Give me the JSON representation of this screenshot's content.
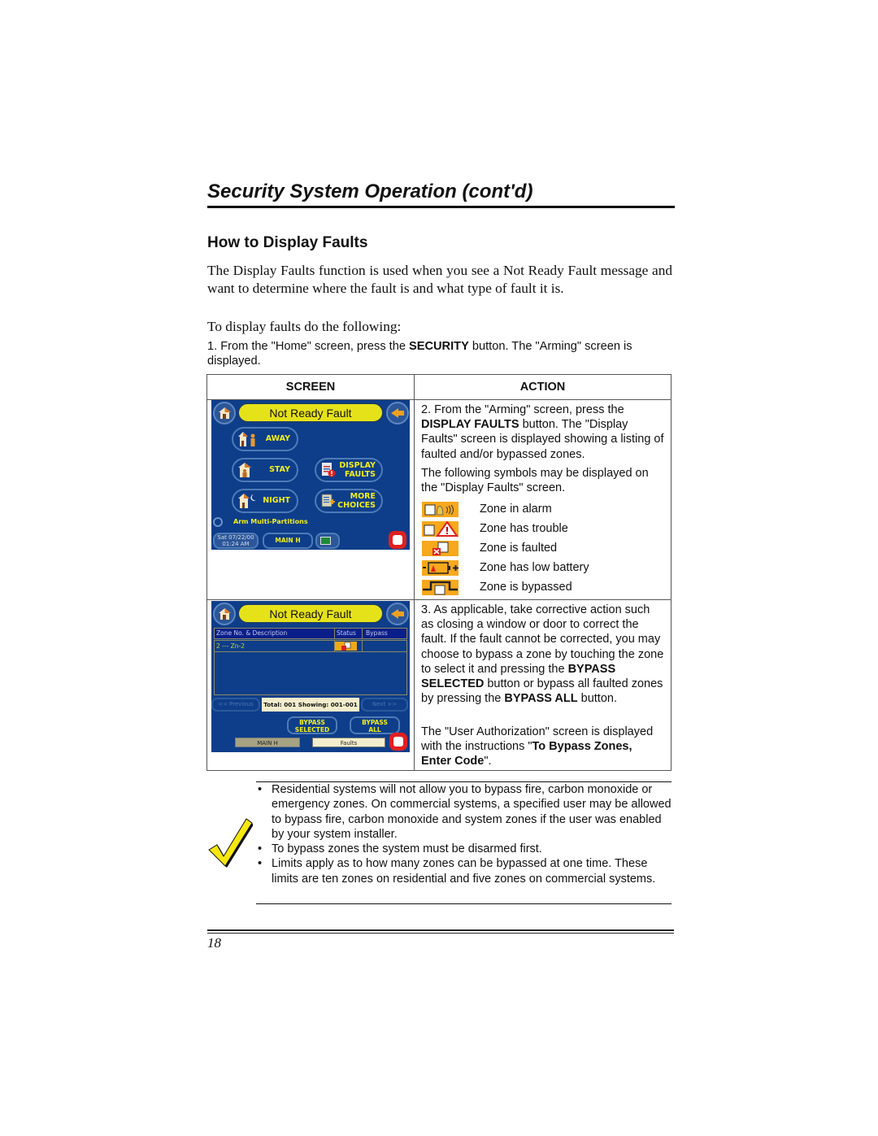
{
  "header": {
    "title": "Security System Operation (cont'd)",
    "section_heading": "How to Display Faults"
  },
  "intro": {
    "paragraph": "The Display Faults function is used when you see a Not Ready Fault message and want to determine where the fault is and what type of fault it is.",
    "lead_in": "To display faults do the following:",
    "step1_prefix": "1.  From the \"Home\" screen, press the ",
    "step1_bold": "SECURITY",
    "step1_suffix": " button.  The \"Arming\" screen is displayed."
  },
  "table": {
    "headers": {
      "screen": "SCREEN",
      "action": "ACTION"
    },
    "row1": {
      "step2_prefix": "2.  From the \"Arming\" screen, press the ",
      "step2_bold": "DISPLAY FAULTS",
      "step2_suffix": " button.  The \"Display Faults\" screen is displayed showing a listing of faulted and/or bypassed zones.",
      "symbols_intro": "The following symbols may be displayed on the \"Display Faults\" screen.",
      "legend": [
        {
          "icon": "zone-alarm-icon",
          "label": "Zone in alarm"
        },
        {
          "icon": "zone-trouble-icon",
          "label": "Zone has trouble"
        },
        {
          "icon": "zone-faulted-icon",
          "label": "Zone is faulted"
        },
        {
          "icon": "zone-low-battery-icon",
          "label": "Zone has low battery"
        },
        {
          "icon": "zone-bypassed-icon",
          "label": "Zone is bypassed"
        }
      ]
    },
    "row2": {
      "step3_a": "3.  As applicable, take corrective action such as closing a window or door to correct the fault. If the fault cannot be corrected, you may choose to bypass a zone by touching the zone to select it and pressing the ",
      "step3_bold1": "BYPASS SELECTED",
      "step3_b": " button or bypass all faulted zones by pressing the ",
      "step3_bold2": "BYPASS ALL",
      "step3_c": " button.",
      "auth_prefix": "The \"User Authorization\" screen is displayed with the instructions \"",
      "auth_bold": "To Bypass Zones, Enter Code",
      "auth_suffix": "\"."
    }
  },
  "arming_screen": {
    "title": "Not Ready Fault",
    "buttons": {
      "away": "AWAY",
      "stay": "STAY",
      "night": "NIGHT",
      "display_faults_1": "DISPLAY",
      "display_faults_2": "FAULTS",
      "more_choices_1": "MORE",
      "more_choices_2": "CHOICES"
    },
    "multi_partitions": "Arm Multi-Partitions",
    "date": "Sat 07/22/00",
    "time": "01:24 AM",
    "main_label": "MAIN H"
  },
  "faults_screen": {
    "title": "Not Ready Fault",
    "columns": [
      "Zone No. & Description",
      "Status",
      "Bypass"
    ],
    "rows": [
      {
        "zone": "2 --- Zn-2",
        "status": "faulted",
        "bypass": ""
      }
    ],
    "previous": "<< Previous",
    "next": "Next >>",
    "total": "Total: 001  Showing: 001-001",
    "bypass_selected_1": "BYPASS",
    "bypass_selected_2": "SELECTED",
    "bypass_all_1": "BYPASS",
    "bypass_all_2": "ALL",
    "tab_main": "MAIN H",
    "tab_faults": "Faults"
  },
  "notes": [
    "Residential systems will not allow you to bypass fire, carbon monoxide or emergency zones. On commercial systems, a specified user may be allowed to bypass fire, carbon monoxide and system zones if the user was enabled by your system installer.",
    "To bypass zones the system must be disarmed first.",
    "Limits apply as to how many zones can be bypassed at one time. These limits are ten zones on residential and five zones on commercial systems."
  ],
  "footer": {
    "page_number": "18"
  },
  "colors": {
    "lcd_background": "#0e3e8a",
    "pill_yellow": "#e6e21a",
    "button_text_yellow": "#f2ee1a",
    "legend_orange": "#f7a81c"
  }
}
